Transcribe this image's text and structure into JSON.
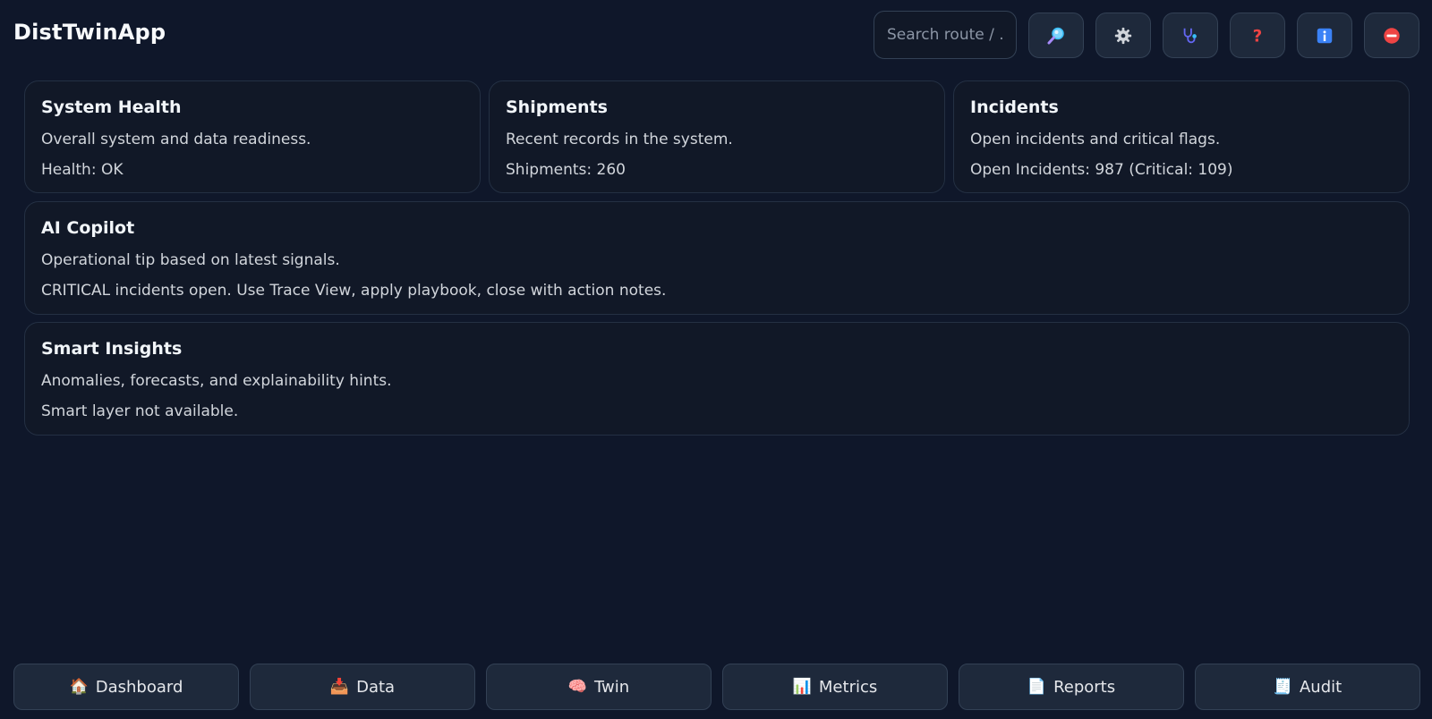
{
  "header": {
    "title": "DistTwinApp",
    "search_placeholder": "Search route / ...",
    "buttons": [
      {
        "name": "search-icon",
        "icon": "magnifier"
      },
      {
        "name": "gear-icon",
        "icon": "gear"
      },
      {
        "name": "stethoscope-icon",
        "icon": "stethoscope"
      },
      {
        "name": "help-icon",
        "icon": "question"
      },
      {
        "name": "info-icon",
        "icon": "info"
      },
      {
        "name": "stop-icon",
        "icon": "no-entry"
      }
    ]
  },
  "cards": {
    "system_health": {
      "title": "System Health",
      "description": "Overall system and data readiness.",
      "value": "Health: OK"
    },
    "shipments": {
      "title": "Shipments",
      "description": "Recent records in the system.",
      "value": "Shipments: 260"
    },
    "incidents": {
      "title": "Incidents",
      "description": "Open incidents and critical flags.",
      "value": "Open Incidents: 987 (Critical: 109)"
    },
    "ai_copilot": {
      "title": "AI Copilot",
      "description": "Operational tip based on latest signals.",
      "value": "CRITICAL incidents open. Use Trace View, apply playbook, close with action notes."
    },
    "smart_insights": {
      "title": "Smart Insights",
      "description": "Anomalies, forecasts, and explainability hints.",
      "value": "Smart layer not available."
    }
  },
  "nav": {
    "items": [
      {
        "label": "Dashboard",
        "icon": "🏠"
      },
      {
        "label": "Data",
        "icon": "📥"
      },
      {
        "label": "Twin",
        "icon": "🧠"
      },
      {
        "label": "Metrics",
        "icon": "📊"
      },
      {
        "label": "Reports",
        "icon": "📄"
      },
      {
        "label": "Audit",
        "icon": "🧾"
      }
    ]
  },
  "colors": {
    "background": "#0f172a",
    "card": "#111827",
    "button": "#1e293b",
    "border": "#334155"
  }
}
